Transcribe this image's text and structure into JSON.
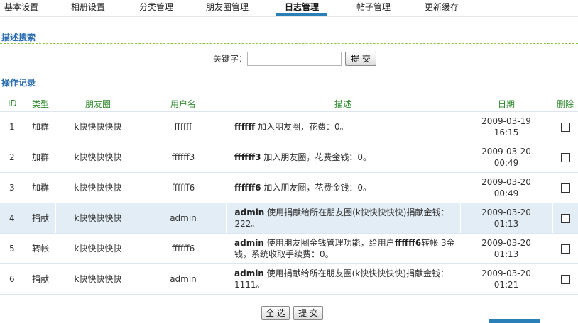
{
  "nav": {
    "tabs": [
      {
        "label": "基本设置",
        "active": false
      },
      {
        "label": "相册设置",
        "active": false
      },
      {
        "label": "分类管理",
        "active": false
      },
      {
        "label": "朋友圈管理",
        "active": false
      },
      {
        "label": "日志管理",
        "active": true
      },
      {
        "label": "帖子管理",
        "active": false
      },
      {
        "label": "更新缓存",
        "active": false
      }
    ]
  },
  "search": {
    "section_title": "描述搜索",
    "keyword_label": "关键字：",
    "keyword_value": "",
    "submit_label": "提 交"
  },
  "log": {
    "section_title": "操作记录",
    "columns": [
      "ID",
      "类型",
      "朋友圈",
      "用户名",
      "描述",
      "日期",
      "删除"
    ],
    "rows": [
      {
        "id": "1",
        "type": "加群",
        "circle": "k快快快快快",
        "user": "ffffff",
        "desc_user": "ffffff",
        "desc_text": " 加入朋友圈，花费：0。",
        "date": "2009-03-19",
        "time": "16:15",
        "checked": false
      },
      {
        "id": "2",
        "type": "加群",
        "circle": "k快快快快快",
        "user": "ffffff3",
        "desc_user": "ffffff3",
        "desc_text": " 加入朋友圈，花费金钱：0。",
        "date": "2009-03-20",
        "time": "00:49",
        "checked": false
      },
      {
        "id": "3",
        "type": "加群",
        "circle": "k快快快快快",
        "user": "ffffff6",
        "desc_user": "ffffff6",
        "desc_text": " 加入朋友圈，花费金钱：0。",
        "date": "2009-03-20",
        "time": "00:49",
        "checked": false
      },
      {
        "id": "4",
        "type": "捐献",
        "circle": "k快快快快快",
        "user": "admin",
        "desc_user": "admin",
        "desc_text": " 使用捐献给所在朋友圈(k快快快快快)捐献金钱：222。",
        "date": "2009-03-20",
        "time": "01:13",
        "checked": false
      },
      {
        "id": "5",
        "type": "转帐",
        "circle": "k快快快快快",
        "user": "ffffff6",
        "desc_user": "admin",
        "desc_text": " 使用朋友圈金钱管理功能，给用户",
        "desc_user2": "ffffff6",
        "desc_text2": "转帐 3金钱，系统收取手续费：0。",
        "date": "2009-03-20",
        "time": "01:13",
        "checked": false
      },
      {
        "id": "6",
        "type": "捐献",
        "circle": "k快快快快快",
        "user": "admin",
        "desc_user": "admin",
        "desc_text": " 使用捐献给所在朋友圈(k快快快快快)捐献金钱：1111。",
        "date": "2009-03-20",
        "time": "01:21",
        "checked": false
      }
    ]
  },
  "footer": {
    "select_all_label": "全 选",
    "submit_label": "提 交"
  },
  "colors": {
    "section_title": "#2a6db0",
    "column_header": "#2e8b2e",
    "highlight_row": "#e3edf6",
    "active_tab_underline": "#2b7fb8",
    "dashed_rule": "#8cc63f"
  }
}
